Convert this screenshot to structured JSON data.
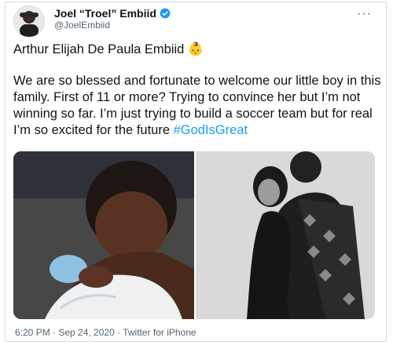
{
  "user": {
    "display_name": "Joel “Troel” Embiid",
    "handle": "@JoelEmbiid",
    "verified_icon": "verified-badge-icon",
    "accent": "#1d9bf0"
  },
  "tweet": {
    "line1": "Arthur Elijah De Paula Embiid 👶",
    "body": "We are so blessed and fortunate to welcome our little boy in this family. First of 11 or more? Trying to convince her but I’m not winning so far. I’m just trying to build a soccer team but for real I’m so excited for the future ",
    "hashtag": "#GodIsGreat"
  },
  "media": {
    "photo1": "hospital-photo-father-holding-newborn",
    "photo2": "black-and-white-couple-maternity-photo"
  },
  "footer": {
    "text": "6:20 PM · Sep 24, 2020 · Twitter for iPhone"
  },
  "more_icon": "ellipsis-icon"
}
